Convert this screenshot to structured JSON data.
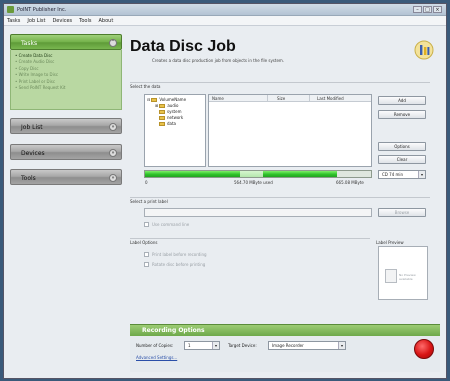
{
  "window": {
    "title": "PoINT Publisher Inc."
  },
  "menu": [
    "Tasks",
    "Job List",
    "Devices",
    "Tools",
    "About"
  ],
  "sidebar": {
    "sections": [
      {
        "label": "Tasks",
        "active": true
      },
      {
        "label": "Job List",
        "active": false
      },
      {
        "label": "Devices",
        "active": false
      },
      {
        "label": "Tools",
        "active": false
      }
    ],
    "tasks": [
      "Create Data Disc",
      "Create Audio Disc",
      "Copy Disc",
      "Write Image to Disc",
      "Print Label or Disc",
      "Send PoINT Request Kit"
    ]
  },
  "main": {
    "title": "Data Disc Job",
    "description": "Creates a data disc production job from objects in the file system.",
    "select_data_label": "Select the data",
    "tree": {
      "root": "VolumeName",
      "folders": [
        "audio",
        "system",
        "network",
        "data"
      ]
    },
    "list_columns": [
      "Name",
      "Size",
      "Last Modified"
    ],
    "buttons": {
      "add": "Add",
      "remove": "Remove",
      "options": "Options",
      "clear": "Clear"
    },
    "capacity": {
      "start": "0",
      "used": "564.70 MByte used",
      "total": "665.08 MByte",
      "used_fraction": 0.85,
      "media": "CD 74 min"
    },
    "print_label_section": "Select a print label",
    "browse": "Browse",
    "use_command_line": "Use command line",
    "label_options": "Label Options",
    "label_preview": "Label Preview",
    "print_before_recording": "Print label before recording",
    "rotate_before_printing": "Rotate disc before printing",
    "preview_text": "No Preview available",
    "recording": {
      "header": "Recording Options",
      "copies_label": "Number of Copies:",
      "copies_value": "1",
      "target_label": "Target Device:",
      "target_value": "Image Recorder",
      "advanced": "Advanced Settings..."
    }
  }
}
